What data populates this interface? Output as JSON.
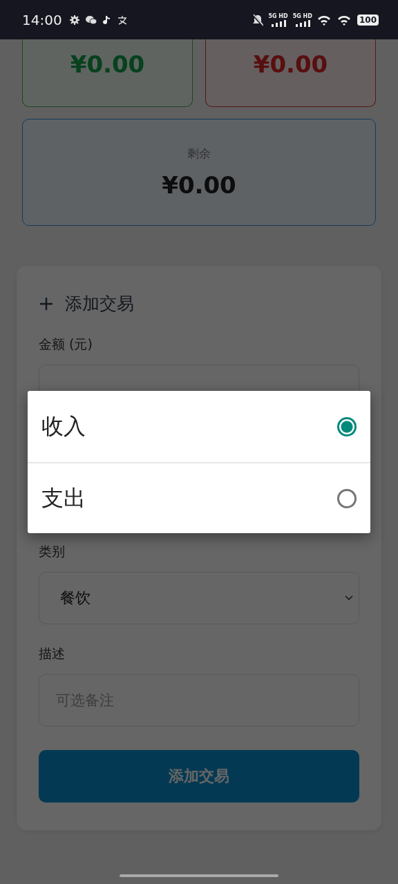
{
  "status_bar": {
    "time": "14:00",
    "sim_1": "5G HD",
    "sim_2": "5G HD",
    "battery": "100"
  },
  "summary": {
    "income": {
      "amount": "¥0.00"
    },
    "expense": {
      "amount": "¥0.00"
    },
    "balance": {
      "label": "剩余",
      "amount": "¥0.00"
    }
  },
  "form": {
    "title": "添加交易",
    "fields": [
      {
        "kind": "input",
        "label": "金额 (元)"
      },
      {
        "kind": "select",
        "label": "类别",
        "value": "餐饮"
      },
      {
        "kind": "input",
        "label": "描述",
        "placeholder": "可选备注"
      }
    ],
    "submit": "添加交易"
  },
  "dialog": {
    "options": [
      {
        "label": "收入",
        "selected": true
      },
      {
        "label": "支出",
        "selected": false
      }
    ]
  }
}
